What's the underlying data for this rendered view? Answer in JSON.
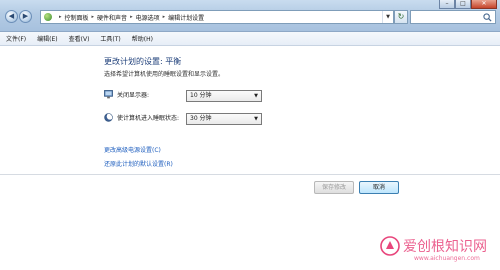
{
  "address_bar": {
    "breadcrumbs": [
      "控制面板",
      "硬件和声音",
      "电源选项",
      "编辑计划设置"
    ],
    "search_placeholder": ""
  },
  "menu": {
    "items": [
      "文件(F)",
      "编辑(E)",
      "查看(V)",
      "工具(T)",
      "帮助(H)"
    ]
  },
  "main": {
    "heading": "更改计划的设置: 平衡",
    "subtext": "选择希望计算机使用的睡眠设置和显示设置。",
    "settings": [
      {
        "label": "关闭显示器:",
        "value": "10 分钟",
        "icon": "monitor-icon"
      },
      {
        "label": "使计算机进入睡眠状态:",
        "value": "30 分钟",
        "icon": "moon-icon"
      }
    ],
    "links": [
      "更改高级电源设置(C)",
      "还原此计划的默认设置(R)"
    ]
  },
  "buttons": {
    "save": "保存修改",
    "cancel": "取消"
  },
  "watermark": {
    "text": "爱创根知识网",
    "url": "www.aichuangen.com"
  },
  "colors": {
    "heading": "#1e3f7a",
    "link": "#1f5fbf",
    "watermark": "#e8467c"
  }
}
